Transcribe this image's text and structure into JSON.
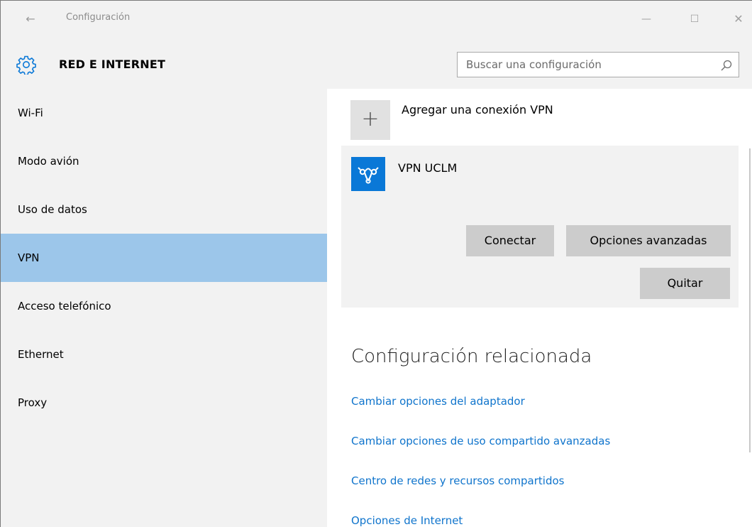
{
  "window": {
    "title": "Configuración",
    "back_glyph": "←",
    "min_glyph": "—",
    "max_glyph": "☐",
    "close_glyph": "✕"
  },
  "header": {
    "title": "RED E INTERNET",
    "search_placeholder": "Buscar una configuración",
    "icon": "gear-icon"
  },
  "sidebar": {
    "items": [
      {
        "label": "Wi-Fi"
      },
      {
        "label": "Modo avión"
      },
      {
        "label": "Uso de datos"
      },
      {
        "label": "VPN",
        "active": true
      },
      {
        "label": "Acceso telefónico"
      },
      {
        "label": "Ethernet"
      },
      {
        "label": "Proxy"
      }
    ],
    "active_color": "#9cc6ea"
  },
  "content": {
    "add_vpn_label": "Agregar una conexión VPN",
    "add_glyph": "+",
    "vpn": {
      "name": "VPN UCLM",
      "icon": "vpn-icon",
      "connect_label": "Conectar",
      "advanced_label": "Opciones avanzadas",
      "remove_label": "Quitar"
    },
    "related": {
      "title": "Configuración relacionada",
      "links": [
        "Cambiar opciones del adaptador",
        "Cambiar opciones de uso compartido avanzadas",
        "Centro de redes y recursos compartidos",
        "Opciones de Internet"
      ]
    }
  },
  "colors": {
    "accent": "#0a78d7",
    "link": "#0f74cc",
    "panel": "#f2f2f2",
    "button": "#cccccc"
  }
}
